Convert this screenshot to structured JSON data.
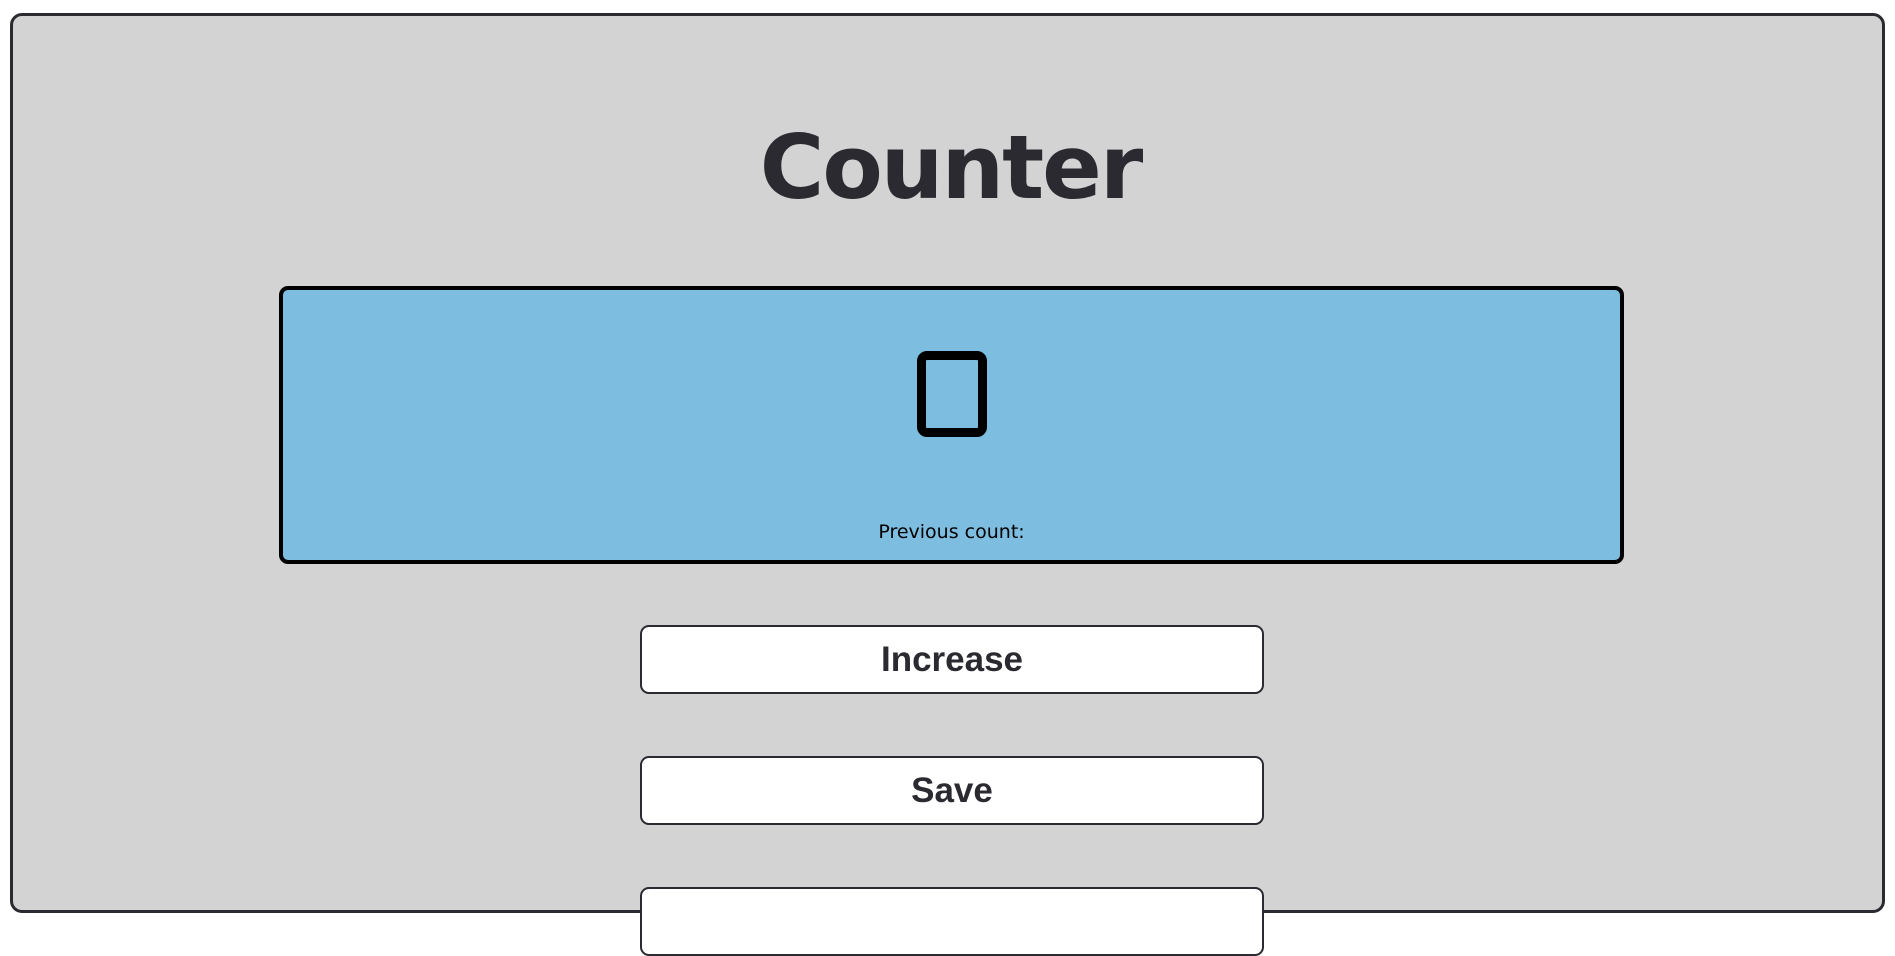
{
  "header": {
    "title": "Counter"
  },
  "counter": {
    "value_icon": "empty-glyph-box",
    "previous_label": "Previous count:",
    "display_color": "#7dbde0"
  },
  "buttons": {
    "increase_label": "Increase",
    "save_label": "Save"
  },
  "colors": {
    "background": "#d3d3d3",
    "border": "#2b2a30",
    "button_background": "#ffffff"
  }
}
